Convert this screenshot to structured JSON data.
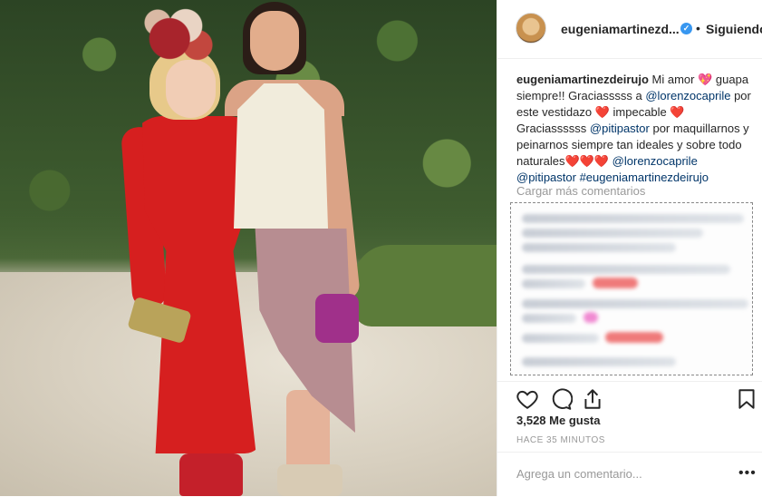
{
  "post": {
    "header": {
      "username": "eugeniamartinezd...",
      "verified": true,
      "separator": "•",
      "follow_label": "Siguiendo"
    },
    "caption": {
      "username": "eugeniamartinezdeirujo",
      "t1": " Mi amor ",
      "t2": " guapa siempre!! Graciasssss a ",
      "m1": "@lorenzocaprile",
      "t3": " por este vestidazo ",
      "t4": " impecable ",
      "t5": " Graciassssss ",
      "m2": "@pitipastor",
      "t6": " por maquillarnos y peinarnos siempre tan ideales y sobre todo naturales",
      "m3": "@lorenzocaprile",
      "m4": "@pitipastor",
      "m5": "#eugeniamartinezdeirujo",
      "heart": "❤️",
      "pink_heart": "💖"
    },
    "load_more": "Cargar más comentarios",
    "likes": "3,528 Me gusta",
    "time": "HACE 35 MINUTOS",
    "comment_placeholder": "Agrega un comentario...",
    "more_glyph": "•••"
  },
  "colors": {
    "mention": "#003569",
    "verified": "#3897f0",
    "muted": "#999999",
    "text": "#262626"
  }
}
